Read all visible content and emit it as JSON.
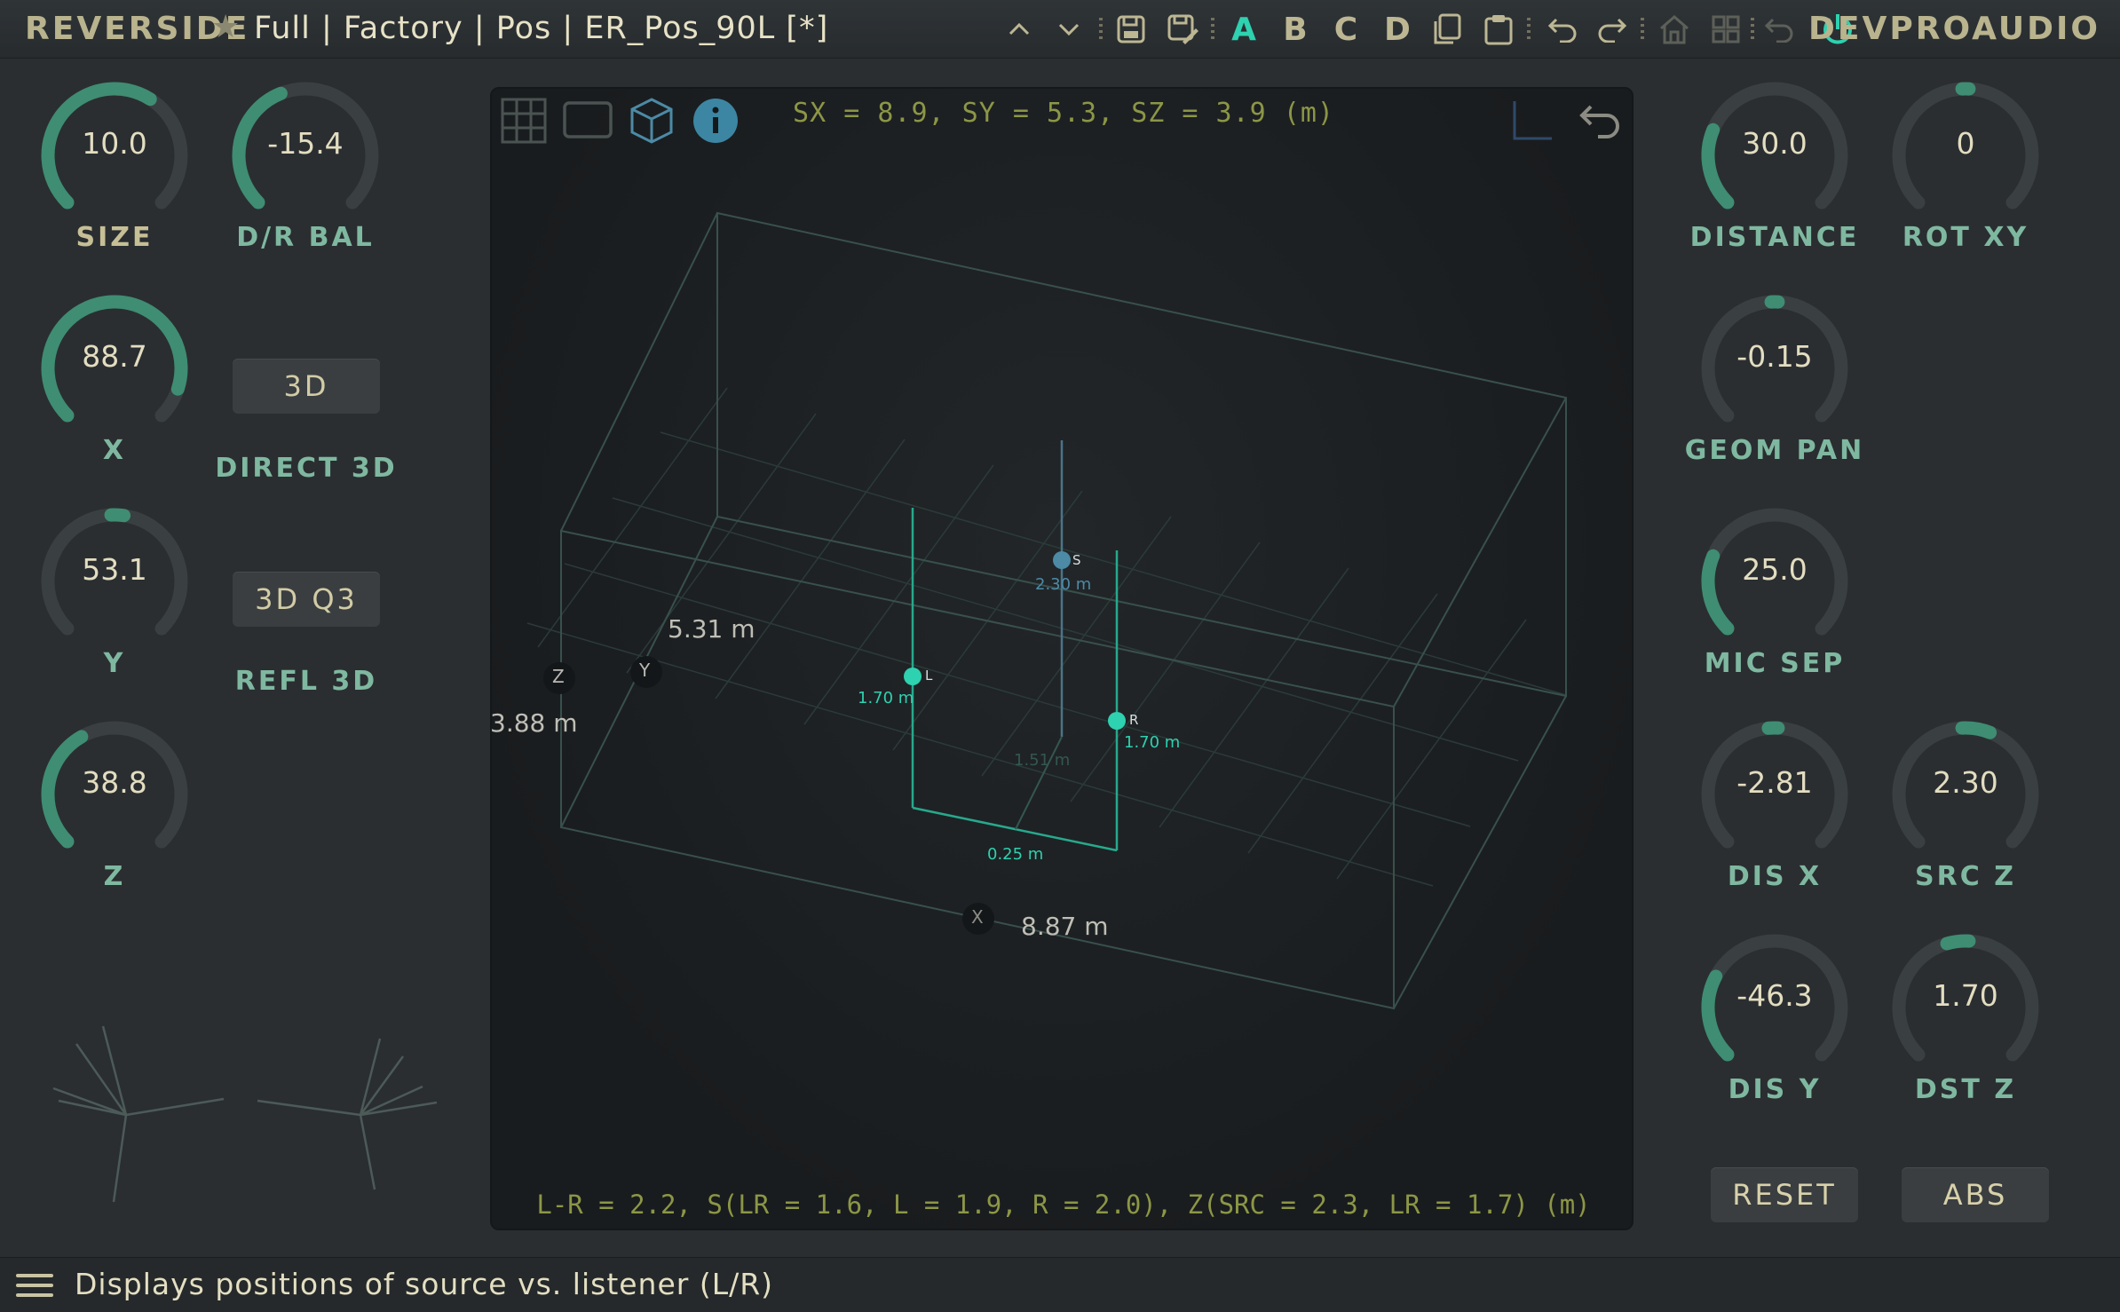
{
  "header": {
    "brand": "REVERSIDE",
    "preset": "Full | Factory | Pos | ER_Pos_90L [*]",
    "slots": [
      "A",
      "B",
      "C",
      "D"
    ],
    "active_slot": "A",
    "vendor": "DEVPROAUDIO",
    "icons": [
      "star-icon",
      "chevron-up-icon",
      "chevron-down-icon",
      "save-icon",
      "save-as-icon",
      "copy-icon",
      "paste-icon",
      "undo-icon",
      "redo-icon",
      "home-icon",
      "grid-icon",
      "back-icon",
      "power-icon"
    ]
  },
  "left_knobs": [
    {
      "id": "size",
      "value": "10.0",
      "label": "SIZE",
      "level": 0.62,
      "label_color": "yellow"
    },
    {
      "id": "dr-bal",
      "value": "-15.4",
      "label": "D/R BAL",
      "level": 0.42
    },
    {
      "id": "x",
      "value": "88.7",
      "label": "X",
      "level": 0.9
    },
    {
      "id": "y",
      "value": "53.1",
      "label": "Y",
      "level": 0.53
    },
    {
      "id": "z",
      "value": "38.8",
      "label": "Z",
      "level": 0.39
    }
  ],
  "left_buttons": [
    {
      "id": "direct-3d",
      "value": "3D",
      "label": "DIRECT 3D"
    },
    {
      "id": "refl-3d",
      "value": "3D Q3",
      "label": "REFL 3D"
    }
  ],
  "right_knobs": [
    {
      "id": "distance",
      "value": "30.0",
      "label": "DISTANCE",
      "level": 0.25
    },
    {
      "id": "rot-xy",
      "value": "0",
      "label": "ROT XY",
      "level": 0.5
    },
    {
      "id": "geom-pan",
      "value": "-0.15",
      "label": "GEOM PAN",
      "level": 0.49
    },
    {
      "id": "mic-sep",
      "value": "25.0",
      "label": "MIC SEP",
      "level": 0.25
    },
    {
      "id": "dis-x",
      "value": "-2.81",
      "label": "DIS X",
      "level": 0.48
    },
    {
      "id": "src-z",
      "value": "2.30",
      "label": "SRC Z",
      "level": 0.58
    },
    {
      "id": "dis-y",
      "value": "-46.3",
      "label": "DIS Y",
      "level": 0.27
    },
    {
      "id": "dst-z",
      "value": "1.70",
      "label": "DST Z",
      "level": 0.44
    }
  ],
  "right_buttons": {
    "reset": "RESET",
    "abs": "ABS"
  },
  "viewport": {
    "dims_text": "SX = 8.9, SY = 5.3, SZ = 3.9 (m)",
    "bottom_text": "L-R = 2.2, S(LR = 1.6, L = 1.9, R = 2.0), Z(SRC = 2.3, LR = 1.7) (m)",
    "length_y": "5.31 m",
    "length_z": "3.88 m",
    "length_x": "8.87 m",
    "axis_z": "Z",
    "axis_y": "Y",
    "axis_x": "X",
    "source": {
      "label": "S",
      "height": "2.30 m"
    },
    "left": {
      "label": "L",
      "height": "1.70 m"
    },
    "right": {
      "label": "R",
      "height": "1.70 m"
    },
    "dist_sl": "1.51 m",
    "dist_lr_offset": "0.25 m"
  },
  "status": {
    "text": "Displays positions of source vs. listener (L/R)"
  },
  "colors": {
    "accent": "#3f8d72",
    "track": "#3a3f42",
    "teal": "#2ed1b0",
    "source": "#4c8aa6",
    "brand": "#b9b38e"
  }
}
